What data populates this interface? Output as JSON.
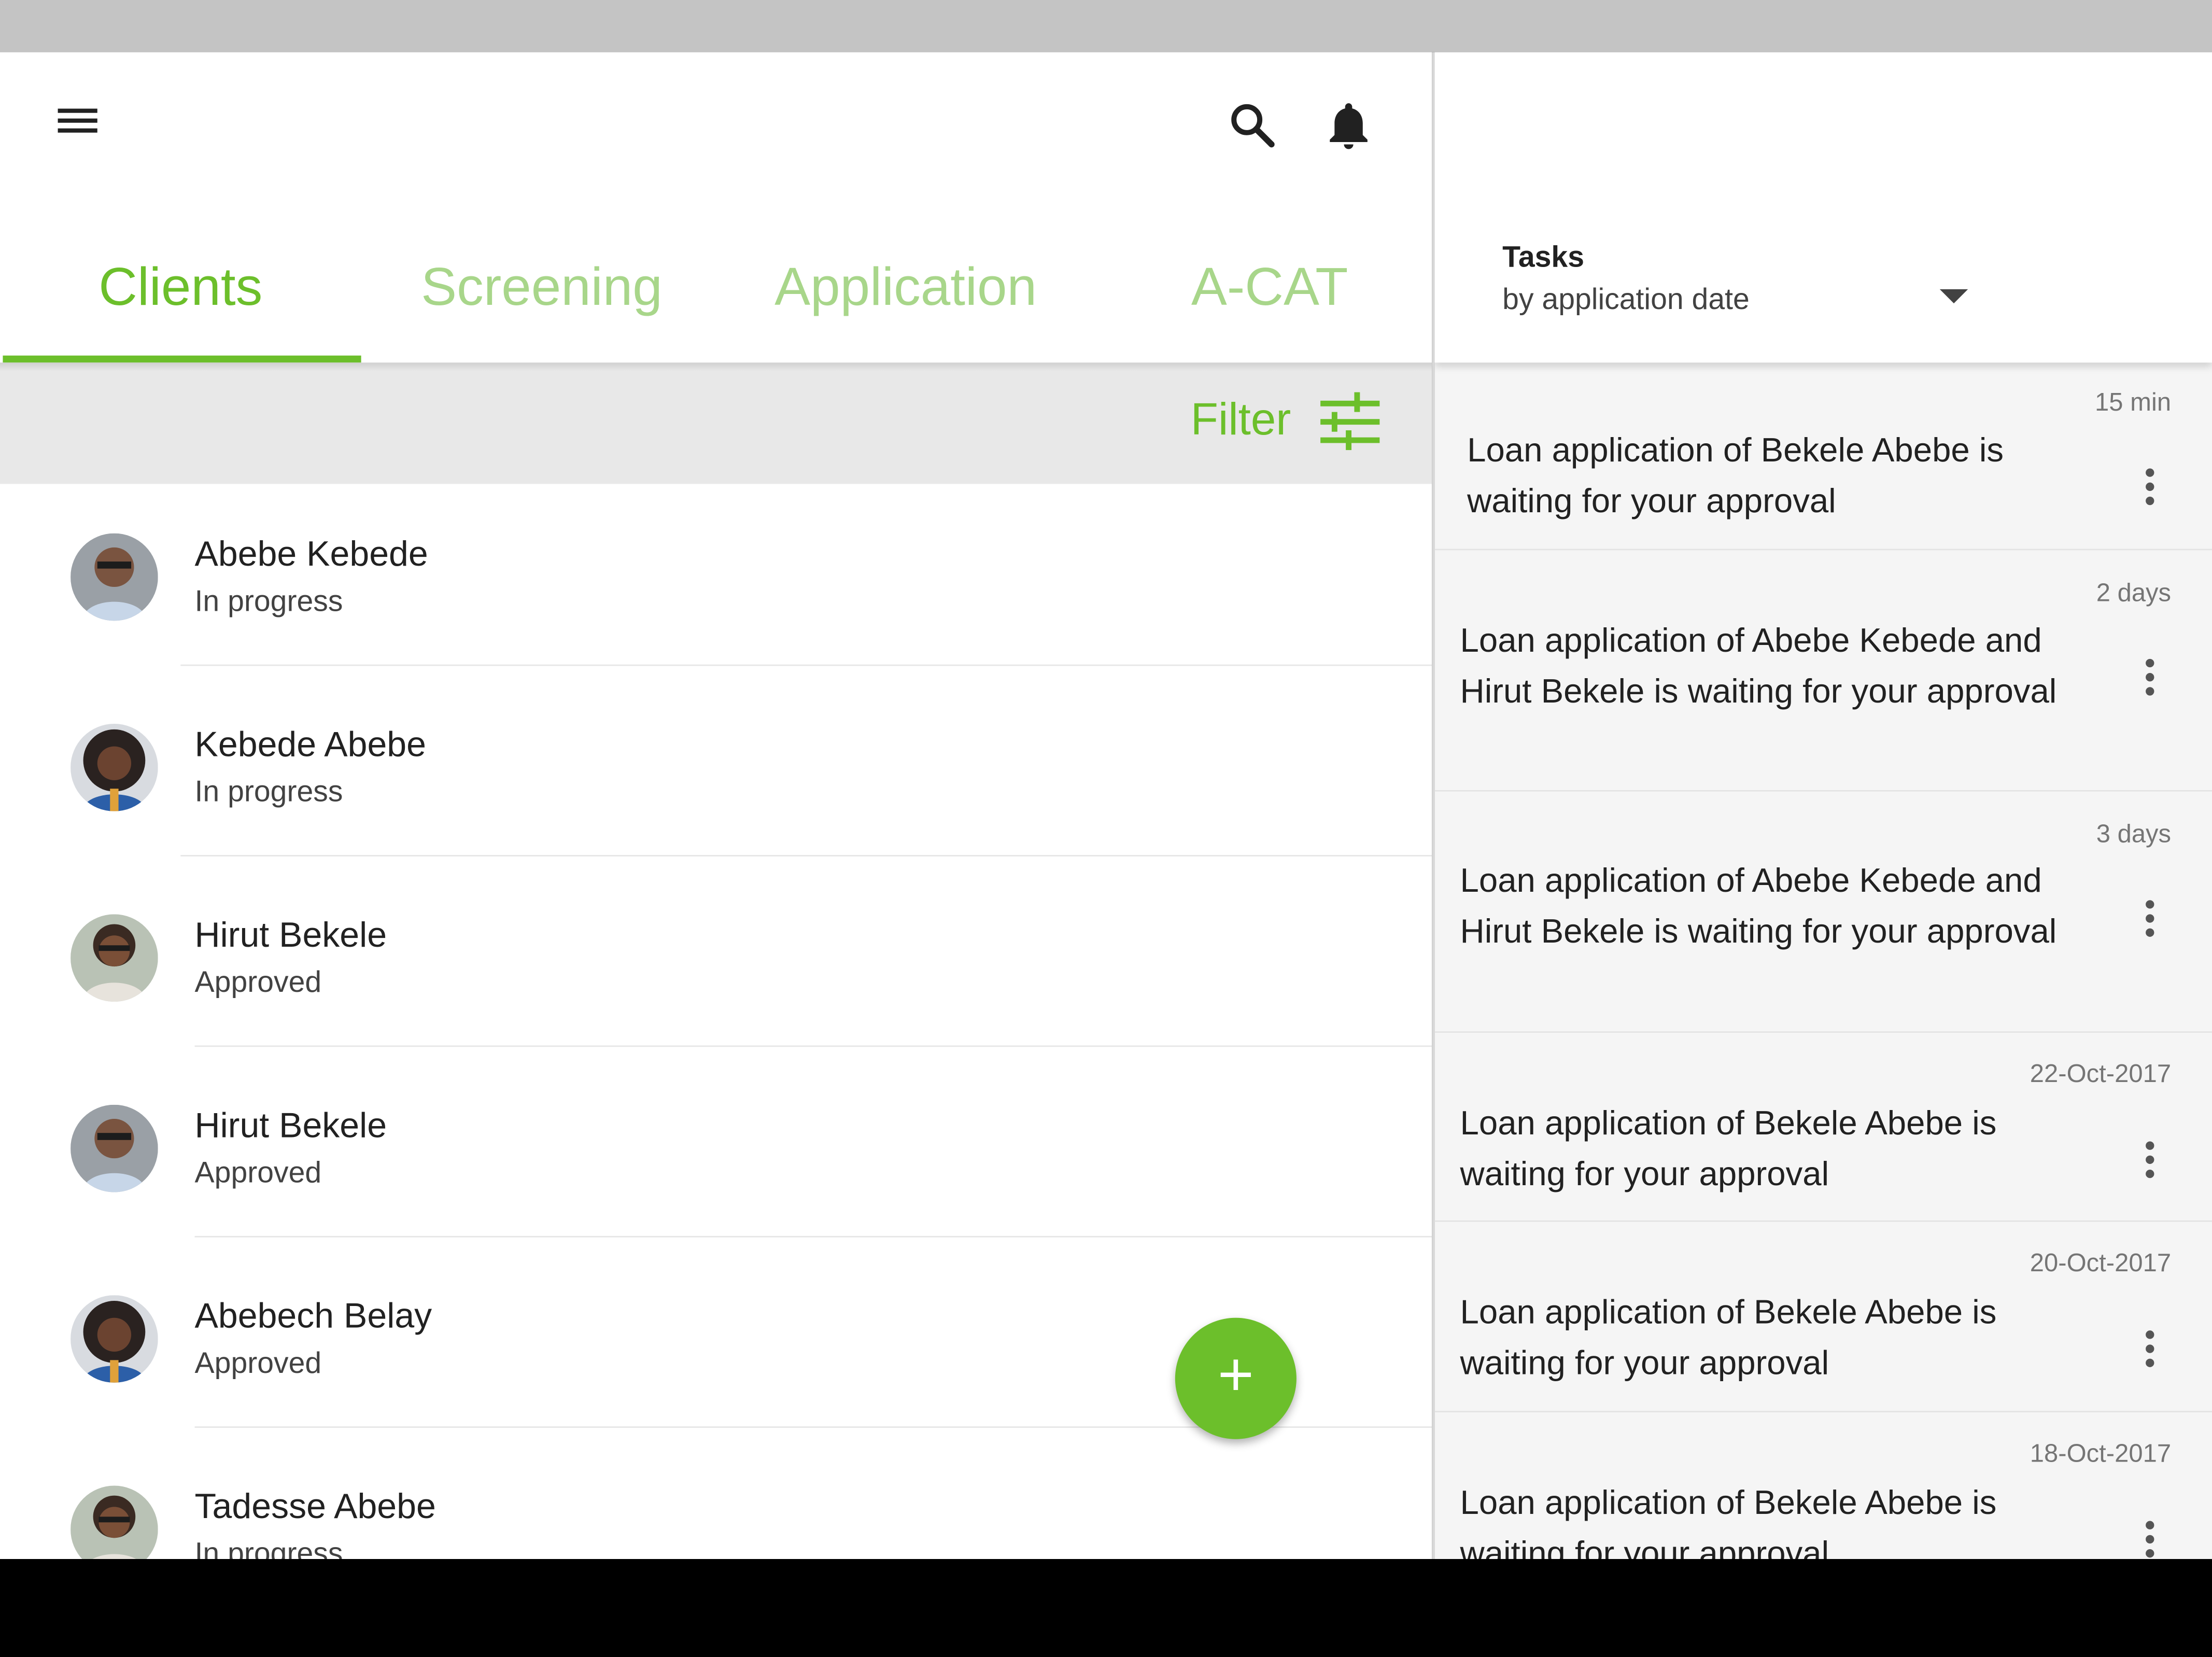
{
  "tabs": [
    {
      "label": "Clients",
      "active": true
    },
    {
      "label": "Screening",
      "active": false
    },
    {
      "label": "Application",
      "active": false
    },
    {
      "label": "A-CAT",
      "active": false
    }
  ],
  "filter": {
    "label": "Filter"
  },
  "clients": [
    {
      "name": "Abebe Kebede",
      "status": "In progress"
    },
    {
      "name": "Kebede Abebe",
      "status": "In progress"
    },
    {
      "name": "Hirut Bekele",
      "status": "Approved"
    },
    {
      "name": "Hirut Bekele",
      "status": "Approved"
    },
    {
      "name": "Abebech Belay",
      "status": "Approved"
    },
    {
      "name": "Tadesse Abebe",
      "status": "In progress"
    }
  ],
  "fab": {
    "label": "+"
  },
  "tasks_panel": {
    "title": "Tasks",
    "sort_label": "by application date",
    "items": [
      {
        "time": "15 min",
        "text": "Loan application of Bekele Abebe is waiting for your approval"
      },
      {
        "time": "2 days",
        "text": "Loan application of Abebe Kebede and Hirut Bekele is waiting for your approval"
      },
      {
        "time": "3 days",
        "text": "Loan application of Abebe Kebede and Hirut Bekele is waiting for your approval"
      },
      {
        "time": "22-Oct-2017",
        "text": "Loan application of Bekele Abebe is waiting for your approval"
      },
      {
        "time": "20-Oct-2017",
        "text": "Loan application of Bekele Abebe is waiting for your approval"
      },
      {
        "time": "18-Oct-2017",
        "text": "Loan application of Bekele Abebe is waiting for your approval"
      }
    ]
  },
  "colors": {
    "accent": "#6cbf2b",
    "accent_light": "#a8d68a"
  }
}
